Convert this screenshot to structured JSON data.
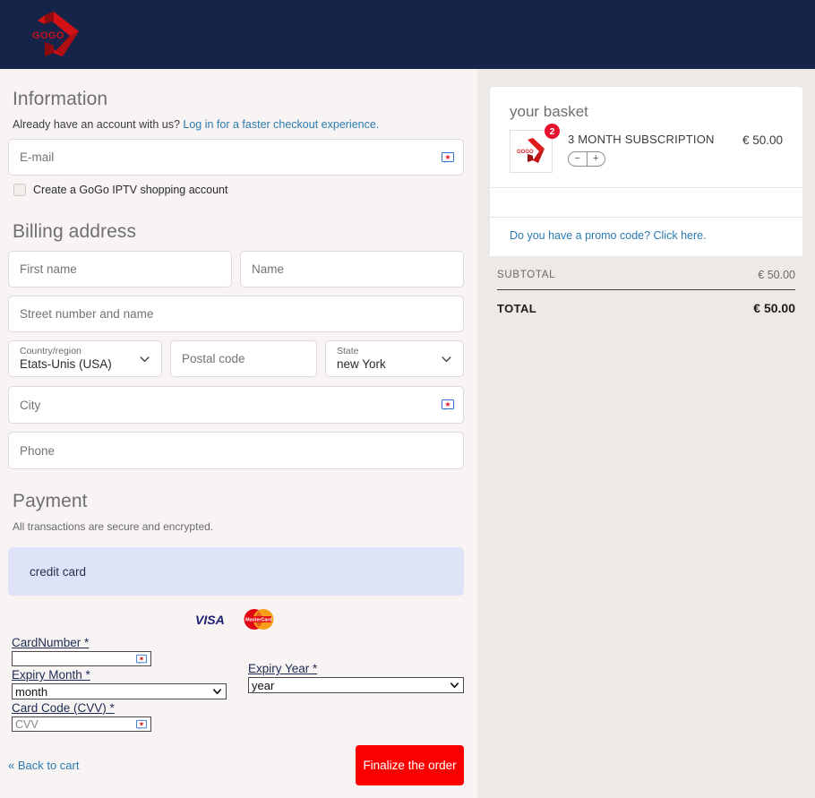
{
  "header": {
    "logo_text": "GOGO",
    "logo_alt": "gogo-logo"
  },
  "information": {
    "title": "Information",
    "account_prompt": "Already have an account with us?",
    "login_link": "Log in for a faster checkout experience.",
    "email_placeholder": "E-mail",
    "create_account_label": "Create a GoGo IPTV shopping account"
  },
  "billing": {
    "title": "Billing address",
    "first_name_placeholder": "First name",
    "last_name_placeholder": "Name",
    "street_placeholder": "Street number and name",
    "country_label": "Country/region",
    "country_value": "Etats-Unis (USA)",
    "postal_placeholder": "Postal code",
    "state_label": "State",
    "state_value": "new York",
    "city_placeholder": "City",
    "phone_placeholder": "Phone"
  },
  "payment": {
    "title": "Payment",
    "secure_note": "All transactions are secure and encrypted.",
    "method_label": "credit card",
    "visa_label": "VISA",
    "mastercard_label": "MasterCard",
    "card_number_label": "CardNumber *",
    "card_number_value": "",
    "expiry_month_label": "Expiry Month *",
    "expiry_month_value": "month",
    "expiry_year_label": "Expiry Year *",
    "expiry_year_value": "year",
    "cvv_label": "Card Code (CVV) *",
    "cvv_placeholder": "CVV"
  },
  "footer": {
    "back_link": "« Back to cart",
    "submit_label": "Finalize the order"
  },
  "basket": {
    "title": "your basket",
    "item": {
      "name": "3 MONTH SUBSCRIPTION",
      "price": "€ 50.00",
      "quantity_badge": "2",
      "minus": "−",
      "plus": "+",
      "thumb_text": "GOGO"
    },
    "promo_text": "Do you have a promo code? Click here.",
    "subtotal_label": "SUBTOTAL",
    "subtotal_value": "€ 50.00",
    "total_label": "TOTAL",
    "total_value": "€ 50.00"
  },
  "colors": {
    "header_bg": "#152448",
    "page_bg": "#f7f4f3",
    "panel_bg": "#ece9e7",
    "accent_red": "#fa0000",
    "link_blue": "#2a7ab0",
    "credit_box": "#dee3f8",
    "badge_red": "#e8112d"
  }
}
